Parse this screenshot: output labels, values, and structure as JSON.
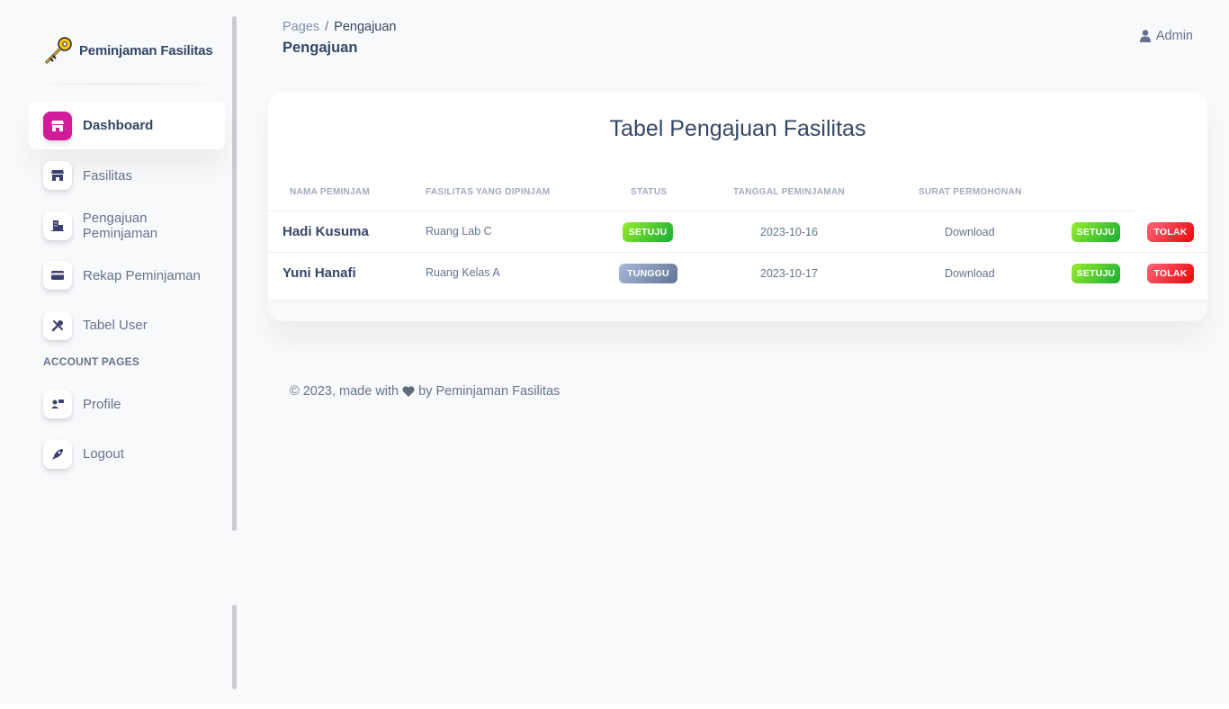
{
  "brand": {
    "name": "Peminjaman Fasilitas",
    "logo_icon": "key-icon"
  },
  "sidebar": {
    "items": [
      {
        "label": "Dashboard",
        "icon": "shop-icon",
        "active": true
      },
      {
        "label": "Fasilitas",
        "icon": "shop-icon"
      },
      {
        "label": "Pengajuan Peminjaman",
        "icon": "office-icon"
      },
      {
        "label": "Rekap Peminjaman",
        "icon": "credit-card-icon"
      },
      {
        "label": "Tabel User",
        "icon": "tools-icon"
      }
    ],
    "section_title": "Account Pages",
    "account_items": [
      {
        "label": "Profile",
        "icon": "profile-icon"
      },
      {
        "label": "Logout",
        "icon": "rocket-icon"
      }
    ]
  },
  "header": {
    "breadcrumb_root": "Pages",
    "breadcrumb_separator": "/",
    "breadcrumb_current": "Pengajuan",
    "page_title": "Pengajuan",
    "user_label": "Admin",
    "user_icon": "user-icon"
  },
  "table": {
    "title": "Tabel Pengajuan Fasilitas",
    "columns": [
      "Nama Peminjam",
      "Fasilitas yang dipinjam",
      "Status",
      "Tanggal Peminjaman",
      "Surat Permohonan"
    ],
    "rows": [
      {
        "name": "Hadi Kusuma",
        "facility": "Ruang Lab C",
        "status": "SETUJU",
        "date": "2023-10-16",
        "letter": "Download",
        "approve": "SETUJU",
        "reject": "TOLAK"
      },
      {
        "name": "Yuni Hanafi",
        "facility": "Ruang Kelas A",
        "status": "TUNGGU",
        "date": "2023-10-17",
        "letter": "Download",
        "approve": "SETUJU",
        "reject": "TOLAK"
      }
    ]
  },
  "footer": {
    "prefix": "© 2023, made with",
    "suffix": "by Peminjaman Fasilitas",
    "icon": "heart-icon"
  },
  "colors": {
    "accent": "#d21b9b",
    "success": "#17ad37",
    "danger": "#ea0606",
    "neutral": "#627594"
  }
}
